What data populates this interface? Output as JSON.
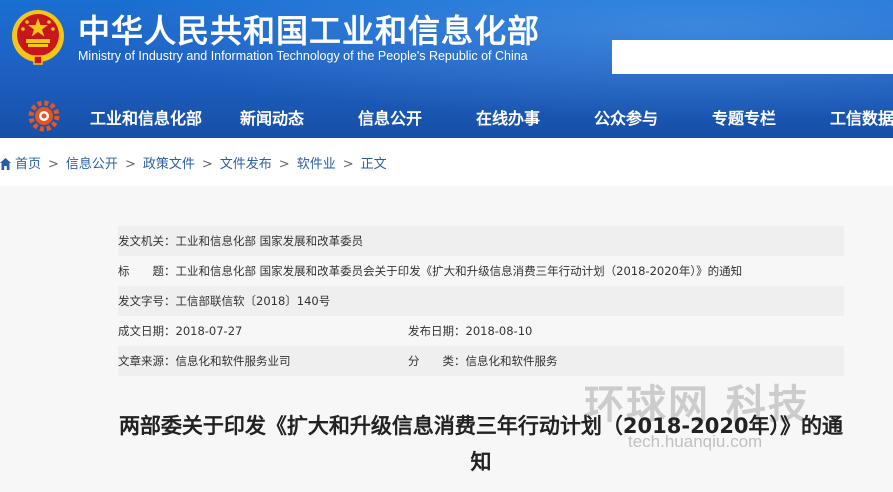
{
  "header": {
    "title": "中华人民共和国工业和信息化部",
    "subtitle": "Ministry of Industry and Information Technology of the People's Republic of China",
    "search_placeholder": ""
  },
  "nav": {
    "items": [
      {
        "label": "工业和信息化部"
      },
      {
        "label": "新闻动态"
      },
      {
        "label": "信息公开"
      },
      {
        "label": "在线办事"
      },
      {
        "label": "公众参与"
      },
      {
        "label": "专题专栏"
      },
      {
        "label": "工信数据"
      }
    ]
  },
  "breadcrumb": {
    "items": [
      "首页",
      "信息公开",
      "政策文件",
      "文件发布",
      "软件业"
    ],
    "current": "正文",
    "separator": ">"
  },
  "meta": {
    "issuer": "发文机关：工业和信息化部 国家发展和改革委员",
    "title_line": "标　　题：工业和信息化部 国家发展和改革委员会关于印发《扩大和升级信息消费三年行动计划（2018-2020年）》的通知",
    "doc_number": "发文字号：工信部联信软〔2018〕140号",
    "created": "成文日期：2018-07-27",
    "published": "发布日期：2018-08-10",
    "source": "文章来源：信息化和软件服务业司",
    "category": "分　　类：信息化和软件服务"
  },
  "article": {
    "title": "两部委关于印发《扩大和升级信息消费三年行动计划（2018-2020年）》的通知"
  },
  "watermark": {
    "main": "环球网 科技",
    "url": "tech.huanqiu.com"
  },
  "colors": {
    "header_blue": "#1f62c4",
    "link_blue": "#2a5fa8",
    "emblem_red": "#c8161d",
    "emblem_gold": "#f5c518"
  }
}
